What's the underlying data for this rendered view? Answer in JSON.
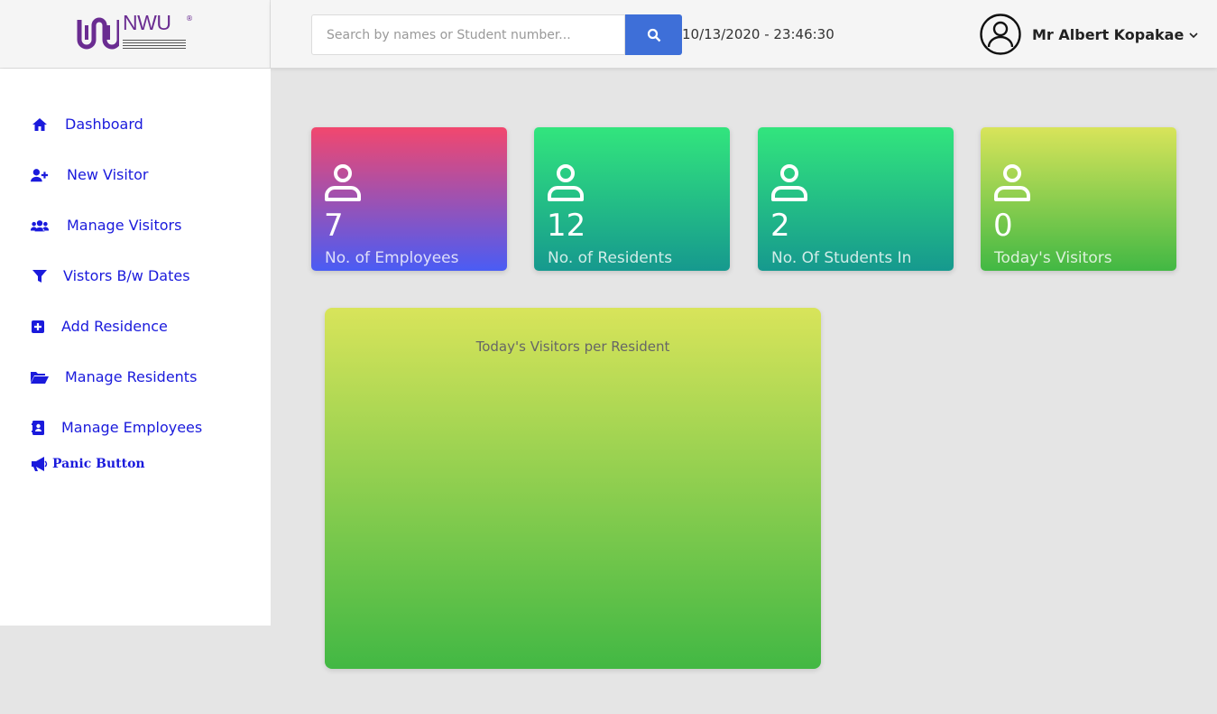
{
  "brand": {
    "name": "NWU",
    "reg": "®"
  },
  "sidebar": {
    "items": [
      {
        "label": "Dashboard",
        "icon": "home-icon"
      },
      {
        "label": "New Visitor",
        "icon": "user-plus-icon"
      },
      {
        "label": "Manage Visitors",
        "icon": "users-icon"
      },
      {
        "label": "Vistors B/w Dates",
        "icon": "filter-icon"
      },
      {
        "label": "Add Residence",
        "icon": "plus-square-icon"
      },
      {
        "label": "Manage Residents",
        "icon": "folder-open-icon"
      },
      {
        "label": "Manage Employees",
        "icon": "address-book-icon"
      }
    ],
    "panic": {
      "label": "Panic Button",
      "icon": "megaphone-icon"
    }
  },
  "header": {
    "search": {
      "placeholder": "Search by names or Student number..."
    },
    "datetime": "10/13/2020 - 23:46:30",
    "user": {
      "name": "Mr Albert Kopakae"
    }
  },
  "cards": [
    {
      "value": "7",
      "label": "No. of Employees"
    },
    {
      "value": "12",
      "label": "No. of Residents"
    },
    {
      "value": "2",
      "label": "No. Of Students In"
    },
    {
      "value": "0",
      "label": "Today's Visitors"
    }
  ],
  "chart_panel": {
    "title": "Today's Visitors per Resident"
  },
  "colors": {
    "accent": "#3e6fd8",
    "nav_text": "#1a1adc",
    "brand": "#6a2c91"
  }
}
